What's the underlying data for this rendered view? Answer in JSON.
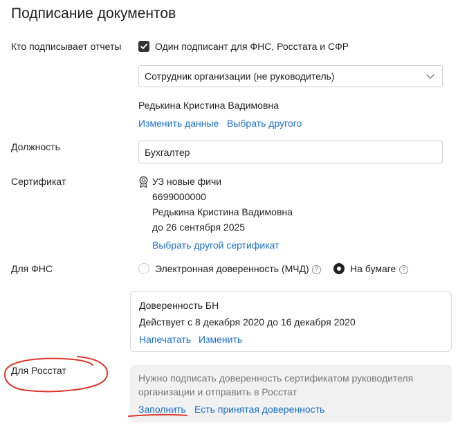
{
  "page": {
    "title": "Подписание документов"
  },
  "signer": {
    "label": "Кто подписывает отчеты",
    "single_signer_checkbox": {
      "label": "Один подписант для ФНС, Росстата и СФР",
      "checked": true
    },
    "role_select": {
      "value": "Сотрудник организации (не руководитель)"
    },
    "person_name": "Редькина Кристина Вадимовна",
    "actions": {
      "edit": "Изменить данные",
      "choose_other": "Выбрать другого"
    }
  },
  "position": {
    "label": "Должность",
    "value": "Бухгалтер"
  },
  "certificate": {
    "label": "Сертификат",
    "icon": "certificate-icon",
    "name": "УЗ новые фичи",
    "inn": "6699000000",
    "owner": "Редькина Кристина Вадимовна",
    "valid_until": "до 26 сентября 2025",
    "choose_other": "Выбрать другой сертификат"
  },
  "fns": {
    "label": "Для ФНС",
    "options": [
      {
        "label": "Электронная доверенность (МЧД)",
        "selected": false
      },
      {
        "label": "На бумаге",
        "selected": true
      }
    ],
    "help_glyph": "?",
    "poa_card": {
      "title": "Доверенность БН",
      "validity": "Действует с 8 декабря 2020 до 16 декабря 2020",
      "actions": {
        "print": "Напечатать",
        "edit": "Изменить"
      }
    }
  },
  "rosstat": {
    "label": "Для Росстат",
    "notice": "Нужно подписать доверенность сертификатом руководителя организации и отправить в Росстат",
    "actions": {
      "fill": "Заполнить",
      "accepted": "Есть принятая доверенность"
    }
  },
  "colors": {
    "link": "#1a6fc9",
    "annotation": "#e0352b",
    "notice_bg": "#f1f1f1",
    "notice_text": "#777777"
  }
}
